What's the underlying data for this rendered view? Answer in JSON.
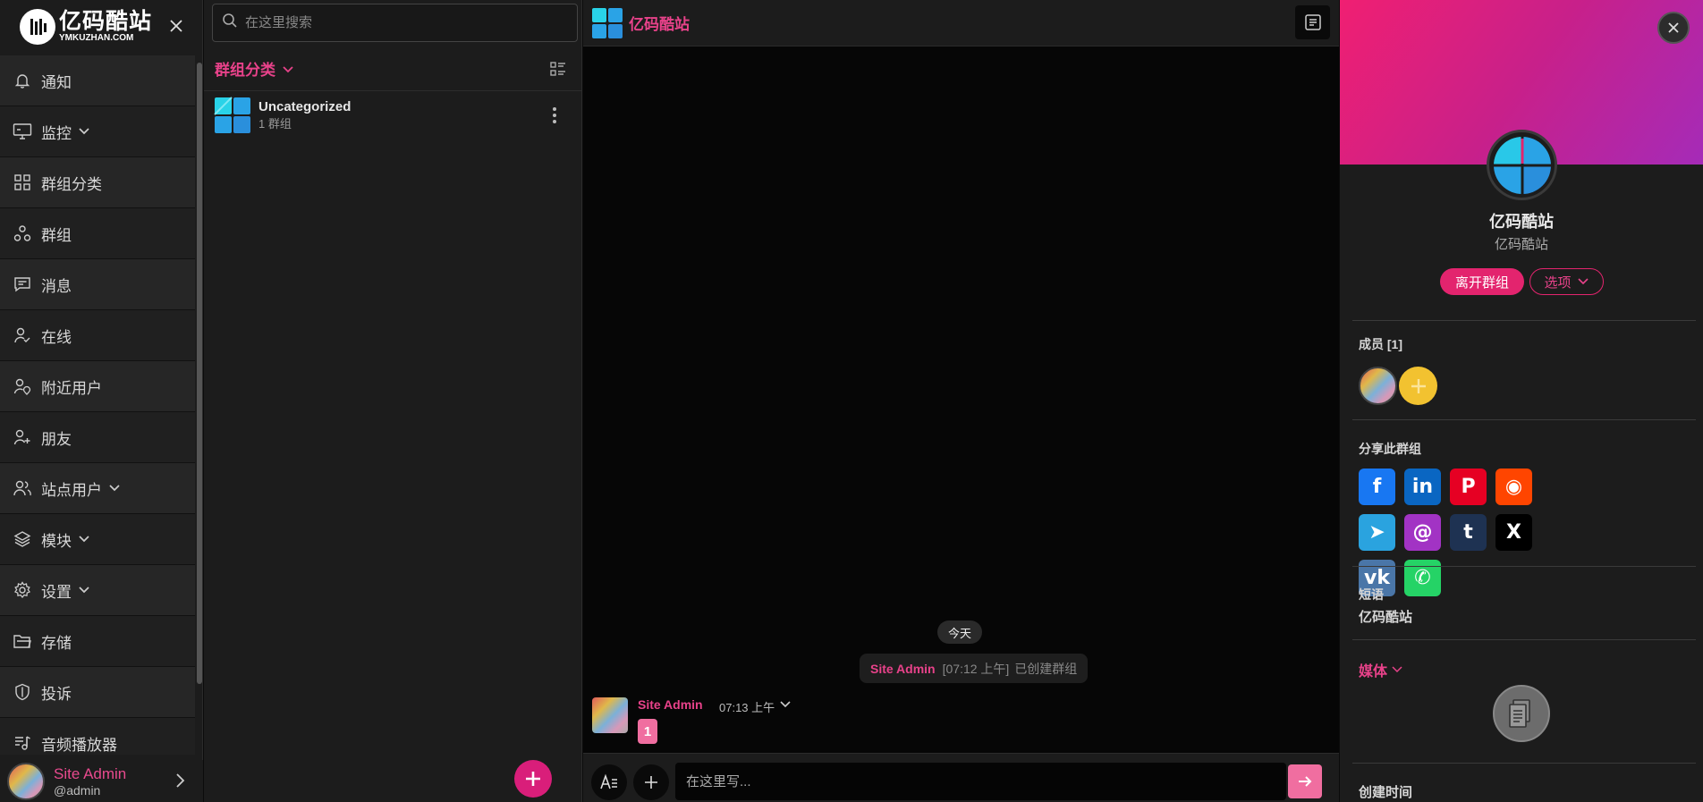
{
  "brand": {
    "name_cn": "亿码酷站",
    "name_en": "YMKUZHAN.COM"
  },
  "sidebar": {
    "items": [
      {
        "label": "通知",
        "icon": "bell-icon",
        "has_chevron": false
      },
      {
        "label": "监控",
        "icon": "monitor-icon",
        "has_chevron": true
      },
      {
        "label": "群组分类",
        "icon": "grid-icon",
        "has_chevron": false
      },
      {
        "label": "群组",
        "icon": "triangle-nodes-icon",
        "has_chevron": false
      },
      {
        "label": "消息",
        "icon": "message-icon",
        "has_chevron": false
      },
      {
        "label": "在线",
        "icon": "user-check-icon",
        "has_chevron": false
      },
      {
        "label": "附近用户",
        "icon": "user-location-icon",
        "has_chevron": false
      },
      {
        "label": "朋友",
        "icon": "user-plus-icon",
        "has_chevron": false
      },
      {
        "label": "站点用户",
        "icon": "users-icon",
        "has_chevron": true
      },
      {
        "label": "模块",
        "icon": "layers-icon",
        "has_chevron": true
      },
      {
        "label": "设置",
        "icon": "gear-icon",
        "has_chevron": true
      },
      {
        "label": "存储",
        "icon": "folder-icon",
        "has_chevron": false
      },
      {
        "label": "投诉",
        "icon": "shield-icon",
        "has_chevron": false
      },
      {
        "label": "音频播放器",
        "icon": "music-list-icon",
        "has_chevron": false
      }
    ],
    "user": {
      "name": "Site Admin",
      "handle": "@admin"
    }
  },
  "listpanel": {
    "search_placeholder": "在这里搜索",
    "category_title": "群组分类",
    "categories": [
      {
        "name": "Uncategorized",
        "count": "1 群组"
      }
    ]
  },
  "chat": {
    "title": "亿码酷站",
    "date_chip": "今天",
    "system_message": {
      "user": "Site Admin",
      "time": "[07:12 上午]",
      "text": "已创建群组"
    },
    "message": {
      "user": "Site Admin",
      "time": "07:13 上午",
      "text": "1"
    },
    "composer_placeholder": "在这里写..."
  },
  "info": {
    "name": "亿码酷站",
    "subtitle": "亿码酷站",
    "leave_label": "离开群组",
    "options_label": "选项",
    "members_title": "成员 [1]",
    "share_title": "分享此群组",
    "share_items": [
      {
        "name": "facebook",
        "glyph": "f",
        "color": "#1877f2"
      },
      {
        "name": "linkedin",
        "glyph": "in",
        "color": "#0a66c2"
      },
      {
        "name": "pinterest",
        "glyph": "P",
        "color": "#e60023"
      },
      {
        "name": "reddit",
        "glyph": "◉",
        "color": "#ff4500"
      },
      {
        "name": "telegram",
        "glyph": "➤",
        "color": "#2aa3df"
      },
      {
        "name": "threads",
        "glyph": "@",
        "color": "#a233c4"
      },
      {
        "name": "tumblr",
        "glyph": "t",
        "color": "#1e3252"
      },
      {
        "name": "x",
        "glyph": "X",
        "color": "#000000"
      },
      {
        "name": "vk",
        "glyph": "vk",
        "color": "#4a76a8"
      },
      {
        "name": "whatsapp",
        "glyph": "✆",
        "color": "#25d366"
      }
    ],
    "bio_label": "短语",
    "bio_value": "亿码酷站",
    "media_title": "媒体",
    "created_label": "创建时间"
  },
  "colors": {
    "accent": "#e8428a",
    "accent_strong": "#e3246e",
    "bg": "#1c1c1c"
  }
}
